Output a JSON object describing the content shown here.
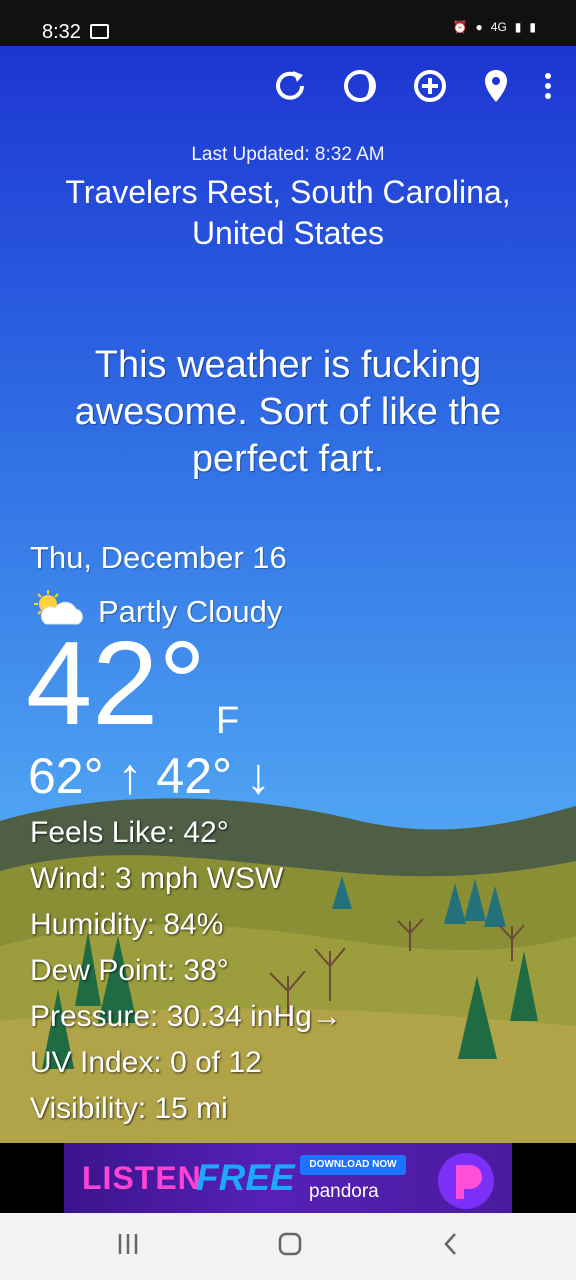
{
  "status_bar": {
    "time": "8:32",
    "network": "4G"
  },
  "toolbar": {
    "items": [
      "refresh-icon",
      "theme-icon",
      "add-location-icon",
      "location-pin-icon",
      "overflow-menu-icon"
    ]
  },
  "header": {
    "last_updated": "Last Updated: 8:32 AM",
    "location_line1": "Travelers Rest, South Carolina,",
    "location_line2": "United States"
  },
  "tagline": {
    "line1": "This weather is fucking",
    "line2": "awesome. Sort of like the",
    "line3": "perfect fart."
  },
  "current": {
    "date": "Thu, December 16",
    "condition": "Partly Cloudy",
    "temperature": "42°",
    "unit": "F",
    "hi_lo": "62° ↑ 42° ↓"
  },
  "details": [
    "Feels Like:  42°",
    "Wind:  3 mph WSW",
    "Humidity:  84%",
    "Dew Point:  38°",
    "Pressure:  30.34 inHg→",
    "UV Index:  0 of 12",
    "Visibility:  15 mi"
  ],
  "ad": {
    "listen": "LISTEN",
    "free": "FREE",
    "download": "DOWNLOAD NOW",
    "brand": "pandora"
  },
  "nav": [
    "recent-apps-icon",
    "home-icon",
    "back-icon"
  ]
}
